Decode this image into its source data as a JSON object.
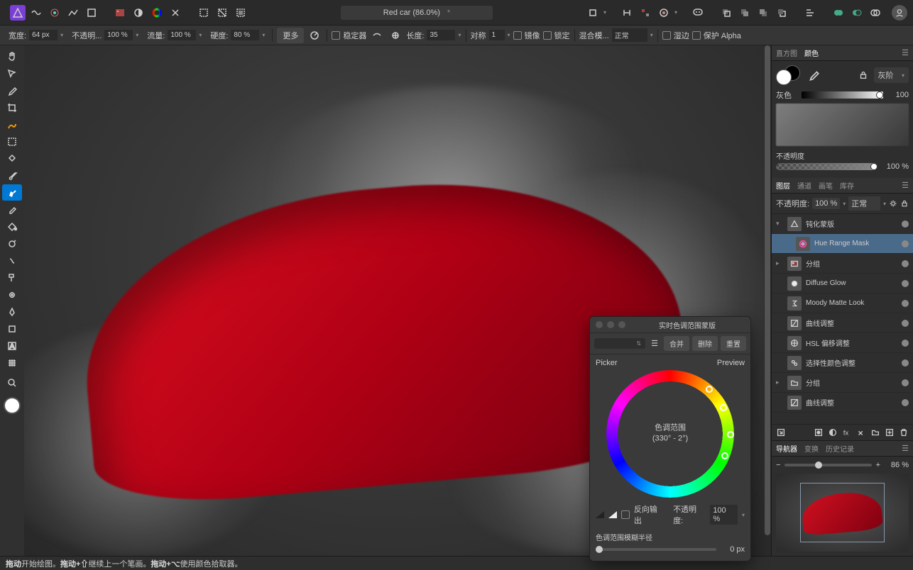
{
  "document": {
    "title": "Red car (86.0%)",
    "starred": "*"
  },
  "context_toolbar": {
    "width_label": "宽度:",
    "width_value": "64 px",
    "opacity_label": "不透明...",
    "opacity_value": "100 %",
    "flow_label": "流量:",
    "flow_value": "100 %",
    "hardness_label": "硬度:",
    "hardness_value": "80 %",
    "more_label": "更多",
    "stabilizer_label": "稳定器",
    "length_label": "长度:",
    "length_value": "35",
    "symmetry_label": "对称",
    "symmetry_value": "1",
    "mirror_label": "镜像",
    "lock_label": "锁定",
    "blend_label": "混合模...",
    "blend_value": "正常",
    "wet_label": "湿边",
    "protect_label": "保护 Alpha"
  },
  "color_panel": {
    "tabs": [
      "直方图",
      "颜色"
    ],
    "mode": "灰阶",
    "gray_label": "灰色",
    "gray_value": "100",
    "opacity_label": "不透明度",
    "opacity_value": "100 %"
  },
  "layers_panel": {
    "tabs": [
      "图层",
      "通道",
      "画笔",
      "库存"
    ],
    "opacity_label": "不透明度:",
    "opacity_value": "100 %",
    "blend_value": "正常",
    "layers": [
      {
        "name": "钝化蒙版",
        "icon": "triangle",
        "indent": 0,
        "expanded": true
      },
      {
        "name": "Hue Range Mask",
        "icon": "hue",
        "indent": 1,
        "selected": true
      },
      {
        "name": "分组",
        "icon": "image",
        "indent": 0,
        "expandable": true
      },
      {
        "name": "Diffuse Glow",
        "icon": "circle",
        "indent": 0
      },
      {
        "name": "Moody Matte Look",
        "icon": "sigma",
        "indent": 0
      },
      {
        "name": "曲线调整",
        "icon": "curve",
        "indent": 0
      },
      {
        "name": "HSL 偏移调整",
        "icon": "hsl",
        "indent": 0
      },
      {
        "name": "选择性颜色调整",
        "icon": "selective",
        "indent": 0
      },
      {
        "name": "分组",
        "icon": "folder",
        "indent": 0,
        "expandable": true
      },
      {
        "name": "曲线调整",
        "icon": "curve",
        "indent": 0
      }
    ]
  },
  "navigator": {
    "tabs": [
      "导航器",
      "变换",
      "历史记录"
    ],
    "zoom_value": "86 %"
  },
  "hue_panel": {
    "title": "实时色调范围蒙版",
    "merge_btn": "合并",
    "delete_btn": "删除",
    "reset_btn": "重置",
    "picker_label": "Picker",
    "preview_label": "Preview",
    "center_label": "色调范围",
    "center_value": "(330° - 2°)",
    "invert_label": "反向输出",
    "opacity_label": "不透明度:",
    "opacity_value": "100 %",
    "blur_label": "色调范围模糊半径",
    "blur_value": "0 px"
  },
  "status_bar": {
    "t1": "拖动",
    "d1": " 开始绘图。",
    "t2": "拖动+⇧",
    "d2": " 继续上一个笔画。",
    "t3": "拖动+⌥",
    "d3": " 使用颜色拾取器。"
  }
}
